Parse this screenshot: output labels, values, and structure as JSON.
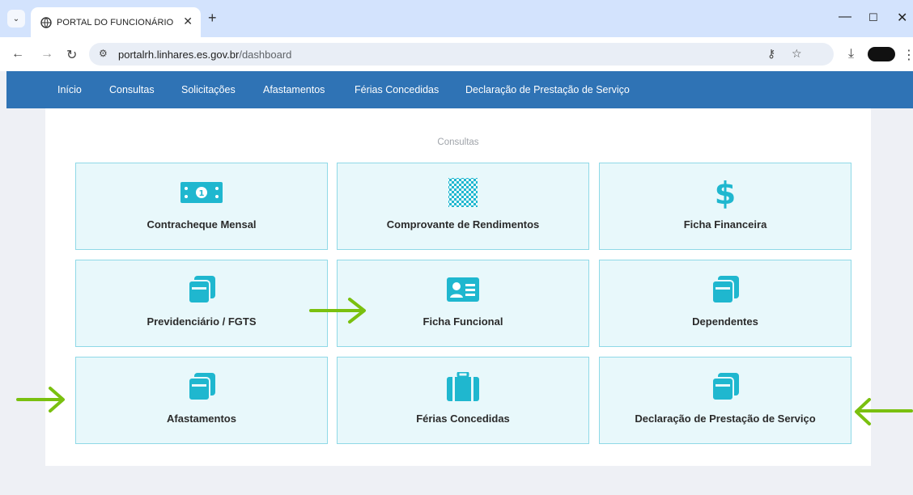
{
  "browser": {
    "tab_title": "PORTAL DO FUNCIONÁRIO",
    "url_host": "portalrh.linhares.es.gov.br",
    "url_path": "/dashboard"
  },
  "nav": {
    "items": [
      "Início",
      "Consultas",
      "Solicitações",
      "Afastamentos",
      "Férias Concedidas",
      "Declaração de Prestação de Serviço"
    ]
  },
  "main": {
    "section_title": "Consultas",
    "cards": [
      {
        "label": "Contracheque Mensal",
        "icon": "money-bill-icon"
      },
      {
        "label": "Comprovante de Rendimentos",
        "icon": "checkered-document-icon"
      },
      {
        "label": "Ficha Financeira",
        "icon": "dollar-icon"
      },
      {
        "label": "Previdenciário / FGTS",
        "icon": "copy-icon"
      },
      {
        "label": "Ficha Funcional",
        "icon": "id-card-icon"
      },
      {
        "label": "Dependentes",
        "icon": "copy-icon"
      },
      {
        "label": "Afastamentos",
        "icon": "copy-icon"
      },
      {
        "label": "Férias Concedidas",
        "icon": "suitcase-icon"
      },
      {
        "label": "Declaração de Prestação de Serviço",
        "icon": "copy-icon"
      }
    ]
  },
  "colors": {
    "nav_bg": "#2f73b5",
    "card_bg": "#e8f8fb",
    "card_border": "#8fd9e7",
    "icon_color": "#1fb7cf",
    "arrow_color": "#7ac00f"
  }
}
